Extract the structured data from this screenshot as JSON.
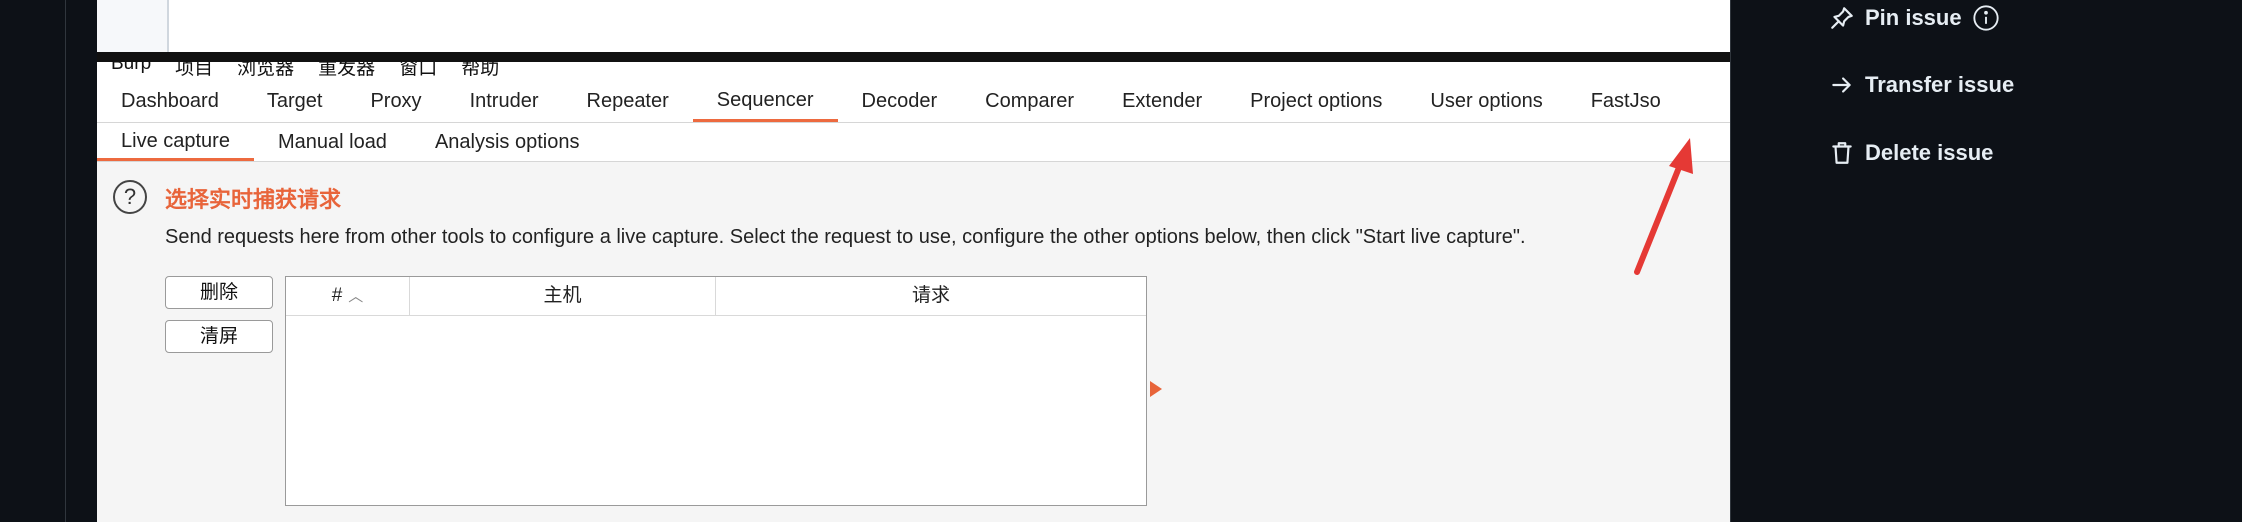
{
  "burp": {
    "menubar": [
      "Burp",
      "项目",
      "浏览器",
      "重发器",
      "窗口",
      "帮助"
    ],
    "tabs": [
      "Dashboard",
      "Target",
      "Proxy",
      "Intruder",
      "Repeater",
      "Sequencer",
      "Decoder",
      "Comparer",
      "Extender",
      "Project options",
      "User options",
      "FastJso"
    ],
    "active_tab": "Sequencer",
    "subtabs": [
      "Live capture",
      "Manual load",
      "Analysis options"
    ],
    "active_subtab": "Live capture",
    "section_title": "选择实时捕获请求",
    "help_icon": "?",
    "description": "Send requests here from other tools to configure a live capture. Select the request to use, configure the other options below, then click \"Start live capture\".",
    "buttons": {
      "remove": "删除",
      "clear": "清屏"
    },
    "table": {
      "columns": [
        {
          "label": "#",
          "sortable": true
        },
        {
          "label": "主机"
        },
        {
          "label": "请求"
        }
      ],
      "rows": []
    },
    "accent_color": "#e8643a"
  },
  "sidebar": {
    "actions": [
      {
        "label": "Pin issue",
        "icon": "pin-icon",
        "info_icon": "info-icon"
      },
      {
        "label": "Transfer issue",
        "icon": "arrow-right-icon"
      },
      {
        "label": "Delete issue",
        "icon": "trash-icon"
      }
    ]
  },
  "annotation": {
    "color": "#e53935",
    "points_to": "FastJso"
  }
}
